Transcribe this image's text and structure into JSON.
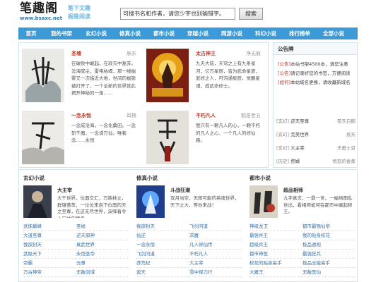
{
  "header": {
    "logo_text": "笔趣阁",
    "logo_url": "www.bsaxc.net",
    "slogan_1": "笔下文趣",
    "slogan_2": "阁是阅读",
    "search_placeholder": "可搜书名和作者，请您少字也别输错字。",
    "search_button": "搜索"
  },
  "nav": [
    "首页",
    "我的书架",
    "玄幻小说",
    "修真小说",
    "都市小说",
    "穿越小说",
    "网游小说",
    "科幻小说",
    "排行榜单",
    "全部小说"
  ],
  "featured": [
    {
      "title": "圣墟",
      "author": "辰东",
      "desc": "在破败中崛起，在寂灭中复苏。沧海成尘，雷电枯竭，那一缕幽雾又一次临近大地，世间的枷锁被打开了，一个全新的世界就此揭开神秘的一角……"
    },
    {
      "title": "太古神王",
      "author": "净无痕",
      "desc": "九天大陆，天穹之上有九条星河，亿万星辰，皆为武命星辰，武修之人，可沟通星辰，觉醒星魂，成武命修士。"
    },
    {
      "title": "一念永恒",
      "author": "耳根",
      "desc": "一念成沧海，一念化桑田。一念斩千魔，一念诛万仙。唯我念……永恒"
    },
    {
      "title": "不朽凡人",
      "author": "鹅是老五",
      "desc": "我只有一颗凡人的心，一颗不朽的凡人之心，一个凡人的修仙路。"
    }
  ],
  "notice": {
    "heading": "公告牌",
    "lines": [
      {
        "tag": "[公告]",
        "text": "本站书架4500本，请您注意"
      },
      {
        "tag": "[公告]",
        "text": "请记录好您的书签，方便阅读"
      },
      {
        "tag": "[如何]",
        "text": "本站域名更换，请收藏新域名"
      }
    ],
    "ranks": [
      {
        "cat": "[玄幻]",
        "name": "逆天至尊",
        "author": "苍天白鹤"
      },
      {
        "cat": "[玄幻]",
        "name": "完美世界",
        "author": "辰东"
      },
      {
        "cat": "[玄幻]",
        "name": "大主宰",
        "author": "天蚕土豆"
      },
      {
        "cat": "[历史]",
        "name": "赘婿",
        "author": "愤怒的香蕉"
      }
    ]
  },
  "lists": [
    {
      "heading": "玄幻小说",
      "feat_title": "大主宰",
      "feat_desc": "大千世界，位面交汇，万族林立，群雄荟萃，一位位来自下位面的天之至尊，在这无尽世界，演绎着令人向往的传奇。",
      "rows": [
        [
          "武炼巅峰",
          "圣墟"
        ],
        [
          "大道至尊",
          "逆天邪神"
        ],
        [
          "我欲封天",
          "真武世界"
        ],
        [
          "武极天下",
          "永恒圣帝"
        ],
        [
          "帝霸",
          "元尊"
        ],
        [
          "万古神帝",
          "无敌剑域"
        ]
      ]
    },
    {
      "heading": "修真小说",
      "feat_title": "斗战狂潮",
      "feat_desc": "双月当空，无限可能的英魂世界，天下之大，等你来战！",
      "rows": [
        [
          "我欲封天",
          "飞剑问道"
        ],
        [
          "仙逆",
          "求魔"
        ],
        [
          "一念永恒",
          "凡人修仙传"
        ],
        [
          "飞剑问道",
          "不朽凡人"
        ],
        [
          "莽荒纪",
          "大主宰"
        ],
        [
          "遮天",
          "雪中悍刀行"
        ]
      ]
    },
    {
      "heading": "都市小说",
      "feat_title": "超品相师",
      "feat_desc": "九字真言，一鼎一世，一幅地图乱世出，看相师如何在都市中崛起称王。",
      "rows": [
        [
          "神级龙卫",
          "都市最强仙帝"
        ],
        [
          "最强兵王",
          "我的贴身校花"
        ],
        [
          "超级兵王",
          "极品透视"
        ],
        [
          "都市神医",
          "最强狂兵"
        ],
        [
          "校花的贴身高手",
          "极品全能高手"
        ],
        [
          "大魔王",
          "无敌医仙"
        ]
      ]
    }
  ]
}
